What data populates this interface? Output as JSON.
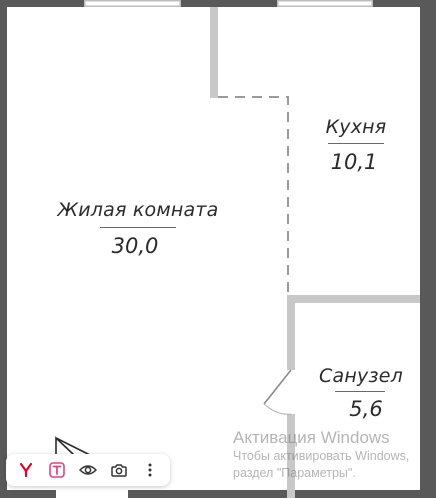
{
  "rooms": {
    "living": {
      "name": "Жилая комната",
      "area": "30,0"
    },
    "kitchen": {
      "name": "Кухня",
      "area": "10,1"
    },
    "bathroom": {
      "name": "Санузел",
      "area": "5,6"
    }
  },
  "watermark": {
    "title": "Активация Windows",
    "line1": "Чтобы активировать Windows,",
    "line2": "раздел \"Параметры\"."
  },
  "toolbar": {
    "icons": [
      "yandex-icon",
      "translate-icon",
      "eye-icon",
      "camera-search-icon",
      "more-icon"
    ],
    "colors": {
      "yandex": "#e4002b",
      "translate": "#e0457b",
      "icon": "#333333"
    }
  },
  "colors": {
    "wall": "#595959",
    "partition": "#c8c8c8",
    "window": "#ffffff"
  }
}
